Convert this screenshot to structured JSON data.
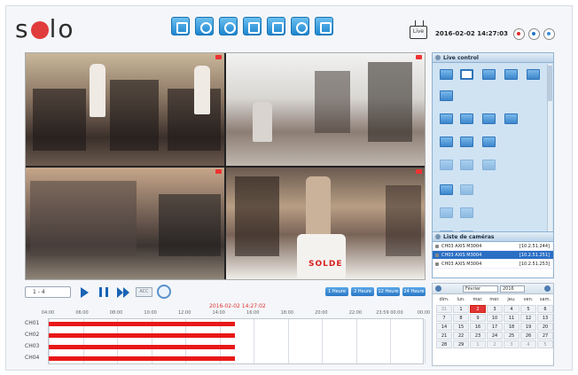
{
  "header": {
    "logo": "solo",
    "toolbar_icons": [
      "wand-icon",
      "gear-icon",
      "search-icon",
      "image-icon",
      "save-icon",
      "help-icon",
      "monitor-icon"
    ],
    "live_label": "Live",
    "datetime": "2016-02-02 14:27:03"
  },
  "videos": {
    "overlay_text": "SOLDE"
  },
  "playback": {
    "view_select": "1 - 4",
    "acc_label": "ACC",
    "hour_buttons": [
      "1 Heure",
      "2 Heure",
      "12 Heure",
      "24 Heure"
    ]
  },
  "timeline": {
    "current_time": "2016-02-02 14:27:02",
    "hours": [
      "04:00",
      "06:00",
      "08:00",
      "10:00",
      "12:00",
      "14:00",
      "16:00",
      "18:00",
      "20:00",
      "22:00",
      "23:59\n00:00",
      "00:00"
    ],
    "channels": [
      "CH01",
      "CH02",
      "CH03",
      "CH04"
    ],
    "recorded_until_fraction": 0.495
  },
  "live_control": {
    "title": "Live control"
  },
  "camera_list": {
    "title": "Liste de caméras",
    "items": [
      {
        "name": "CH03 AXIS M3004",
        "ip": "[10.2.51.244]",
        "active": false
      },
      {
        "name": "CH03 AXIS M3004",
        "ip": "[10.2.51.251]",
        "active": true
      },
      {
        "name": "CH03 AXIS M3004",
        "ip": "[10.2.51.253]",
        "active": false
      }
    ]
  },
  "calendar": {
    "month": "Février",
    "year": "2016",
    "weekdays": [
      "dim.",
      "lun.",
      "mar.",
      "mer.",
      "jeu.",
      "ven.",
      "sam."
    ],
    "weeks": [
      [
        "31",
        "1",
        "2",
        "3",
        "4",
        "5",
        "6"
      ],
      [
        "7",
        "8",
        "9",
        "10",
        "11",
        "12",
        "13"
      ],
      [
        "14",
        "15",
        "16",
        "17",
        "18",
        "19",
        "20"
      ],
      [
        "21",
        "22",
        "23",
        "24",
        "25",
        "26",
        "27"
      ],
      [
        "28",
        "29",
        "1",
        "2",
        "3",
        "4",
        "5"
      ]
    ],
    "today": "2",
    "colors": {
      "today": "#e23535",
      "accent": "#2a6fc4"
    }
  }
}
